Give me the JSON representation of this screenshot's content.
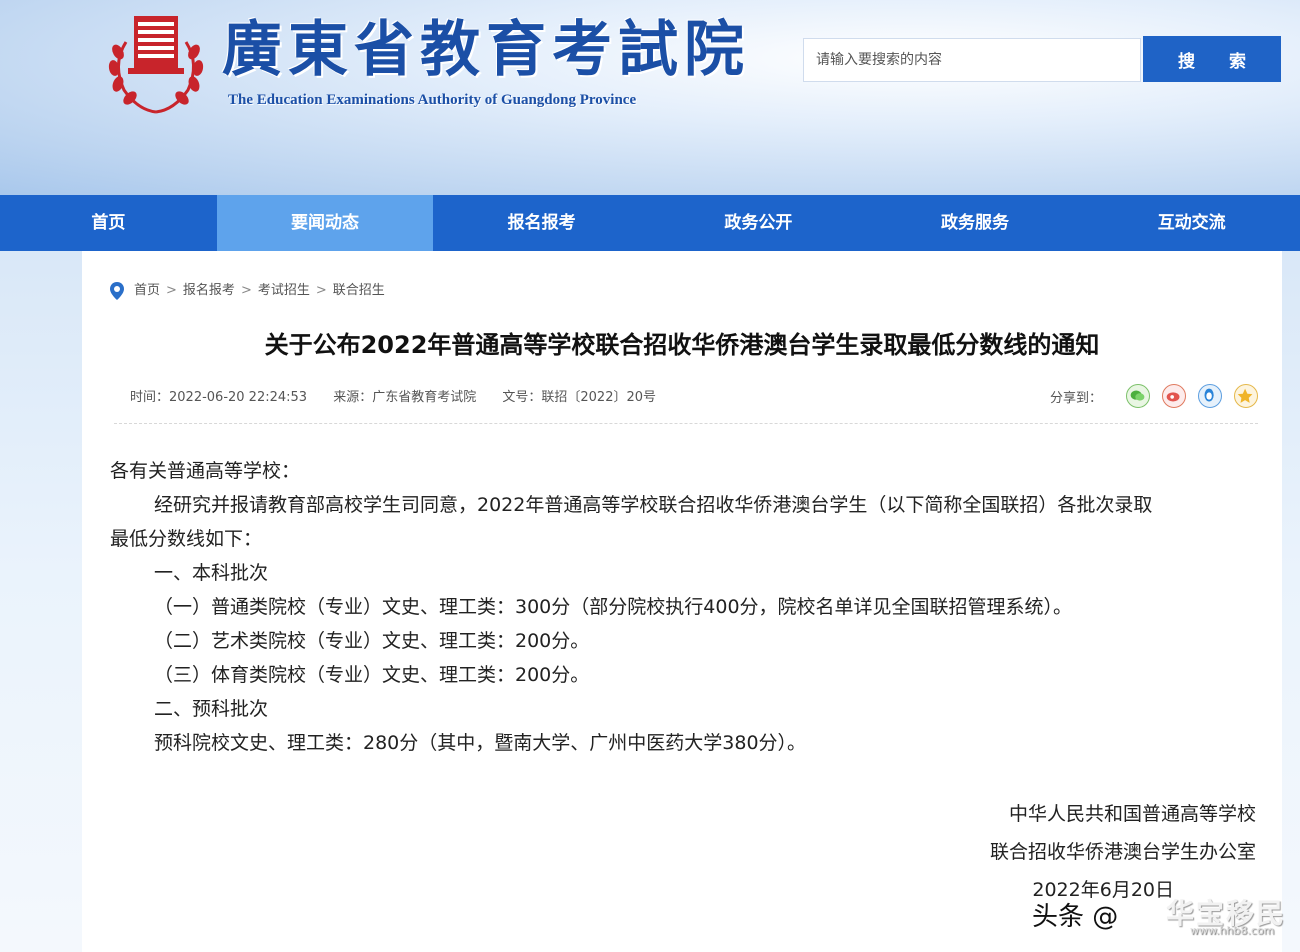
{
  "header": {
    "logo_text": "考試院",
    "title": "廣東省教育考試院",
    "subtitle": "The Education Examinations Authority of Guangdong Province",
    "search_placeholder": "请输入要搜索的内容",
    "search_button": "搜 索"
  },
  "nav": {
    "items": [
      {
        "label": "首页"
      },
      {
        "label": "要闻动态"
      },
      {
        "label": "报名报考"
      },
      {
        "label": "政务公开"
      },
      {
        "label": "政务服务"
      },
      {
        "label": "互动交流"
      }
    ],
    "active_index": 1
  },
  "breadcrumb": {
    "items": [
      "首页",
      "报名报考",
      "考试招生",
      "联合招生"
    ],
    "separator": ">"
  },
  "article": {
    "title": "关于公布2022年普通高等学校联合招收华侨港澳台学生录取最低分数线的通知",
    "meta": {
      "time": "时间：2022-06-20 22:24:53",
      "source": "来源：广东省教育考试院",
      "doc_no": "文号：联招〔2022〕20号"
    },
    "share_label": "分享到：",
    "salutation": "各有关普通高等学校：",
    "intro_line1": "经研究并报请教育部高校学生司同意，2022年普通高等学校联合招收华侨港澳台学生（以下简称全国联招）各批次录取",
    "intro_line2": "最低分数线如下：",
    "section1": "一、本科批次",
    "item1": "（一）普通类院校（专业）文史、理工类：300分（部分院校执行400分，院校名单详见全国联招管理系统）。",
    "item2": "（二）艺术类院校（专业）文史、理工类：200分。",
    "item3": "（三）体育类院校（专业）文史、理工类：200分。",
    "section2": "二、预科批次",
    "item4": "预科院校文史、理工类：280分（其中，暨南大学、广州中医药大学380分）。",
    "sign_line1": "中华人民共和国普通高等学校",
    "sign_line2": "联合招收华侨港澳台学生办公室",
    "sign_date": "2022年6月20日"
  },
  "watermark": {
    "text": "头条 @",
    "brand": "华宝移民",
    "url": "www.hhb8.com"
  },
  "colors": {
    "nav_bg": "#1d64cb",
    "nav_active": "#5ea3ec",
    "brand_red": "#c8242b",
    "title_blue": "#1b4fa6"
  }
}
